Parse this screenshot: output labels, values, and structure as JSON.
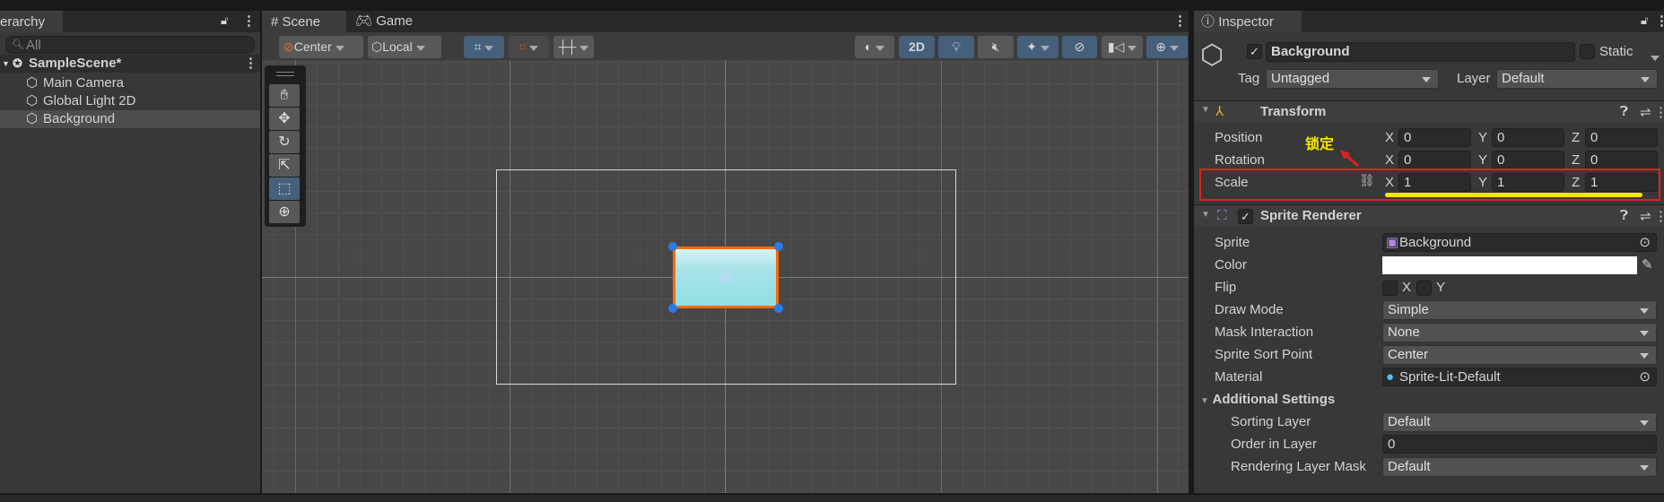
{
  "hierarchy": {
    "tab": "erarchy",
    "search_placeholder": "All",
    "scene": "SampleScene*",
    "items": [
      "Main Camera",
      "Global Light 2D",
      "Background"
    ]
  },
  "scene": {
    "tabs": [
      "Scene",
      "Game"
    ],
    "pivot": "Center",
    "space": "Local",
    "mode_2d": "2D"
  },
  "inspector": {
    "tab": "Inspector",
    "name": "Background",
    "static_label": "Static",
    "tag_label": "Tag",
    "tag": "Untagged",
    "layer_label": "Layer",
    "layer": "Default",
    "transform": {
      "title": "Transform",
      "rows": [
        {
          "label": "Position",
          "x": "0",
          "y": "0",
          "z": "0"
        },
        {
          "label": "Rotation",
          "x": "0",
          "y": "0",
          "z": "0"
        },
        {
          "label": "Scale",
          "x": "1",
          "y": "1",
          "z": "1"
        }
      ],
      "axes": [
        "X",
        "Y",
        "Z"
      ]
    },
    "annotation": "锁定",
    "sprite_renderer": {
      "title": "Sprite Renderer",
      "sprite_label": "Sprite",
      "sprite": "Background",
      "color_label": "Color",
      "color_value": "#ffffff",
      "flip_label": "Flip",
      "flip_x": "X",
      "flip_y": "Y",
      "draw_mode_label": "Draw Mode",
      "draw_mode": "Simple",
      "mask_label": "Mask Interaction",
      "mask": "None",
      "sort_point_label": "Sprite Sort Point",
      "sort_point": "Center",
      "material_label": "Material",
      "material": "Sprite-Lit-Default",
      "additional": "Additional Settings",
      "sorting_layer_label": "Sorting Layer",
      "sorting_layer": "Default",
      "order_label": "Order in Layer",
      "order": "0",
      "rlm_label": "Rendering Layer Mask",
      "rlm": "Default"
    }
  },
  "colors": {
    "accent": "#46607c",
    "highlight_box": "#e02020",
    "underline": "#f5e600",
    "selection": "#ff6a00"
  }
}
